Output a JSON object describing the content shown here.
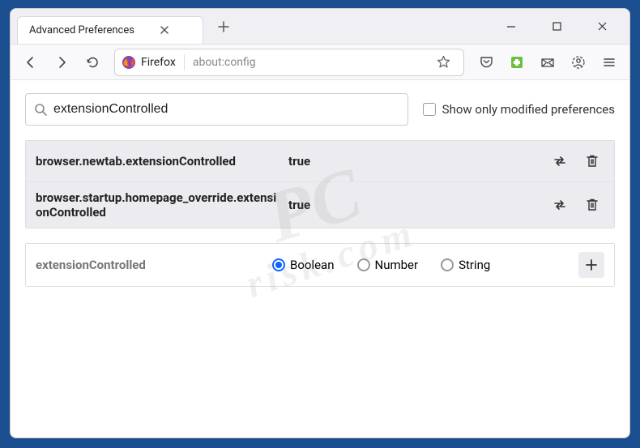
{
  "window": {
    "tab_title": "Advanced Preferences"
  },
  "toolbar": {
    "identity_label": "Firefox",
    "url": "about:config"
  },
  "config": {
    "search_value": "extensionControlled",
    "show_modified_label": "Show only modified preferences",
    "rows": [
      {
        "name": "browser.newtab.extensionControlled",
        "value": "true"
      },
      {
        "name": "browser.startup.homepage_override.extensionControlled",
        "value": "true"
      }
    ],
    "add": {
      "name": "extensionControlled",
      "options": {
        "boolean": "Boolean",
        "number": "Number",
        "string": "String"
      },
      "selected": "boolean"
    }
  },
  "watermark": {
    "line1": "PC",
    "line2": "risk.com"
  }
}
